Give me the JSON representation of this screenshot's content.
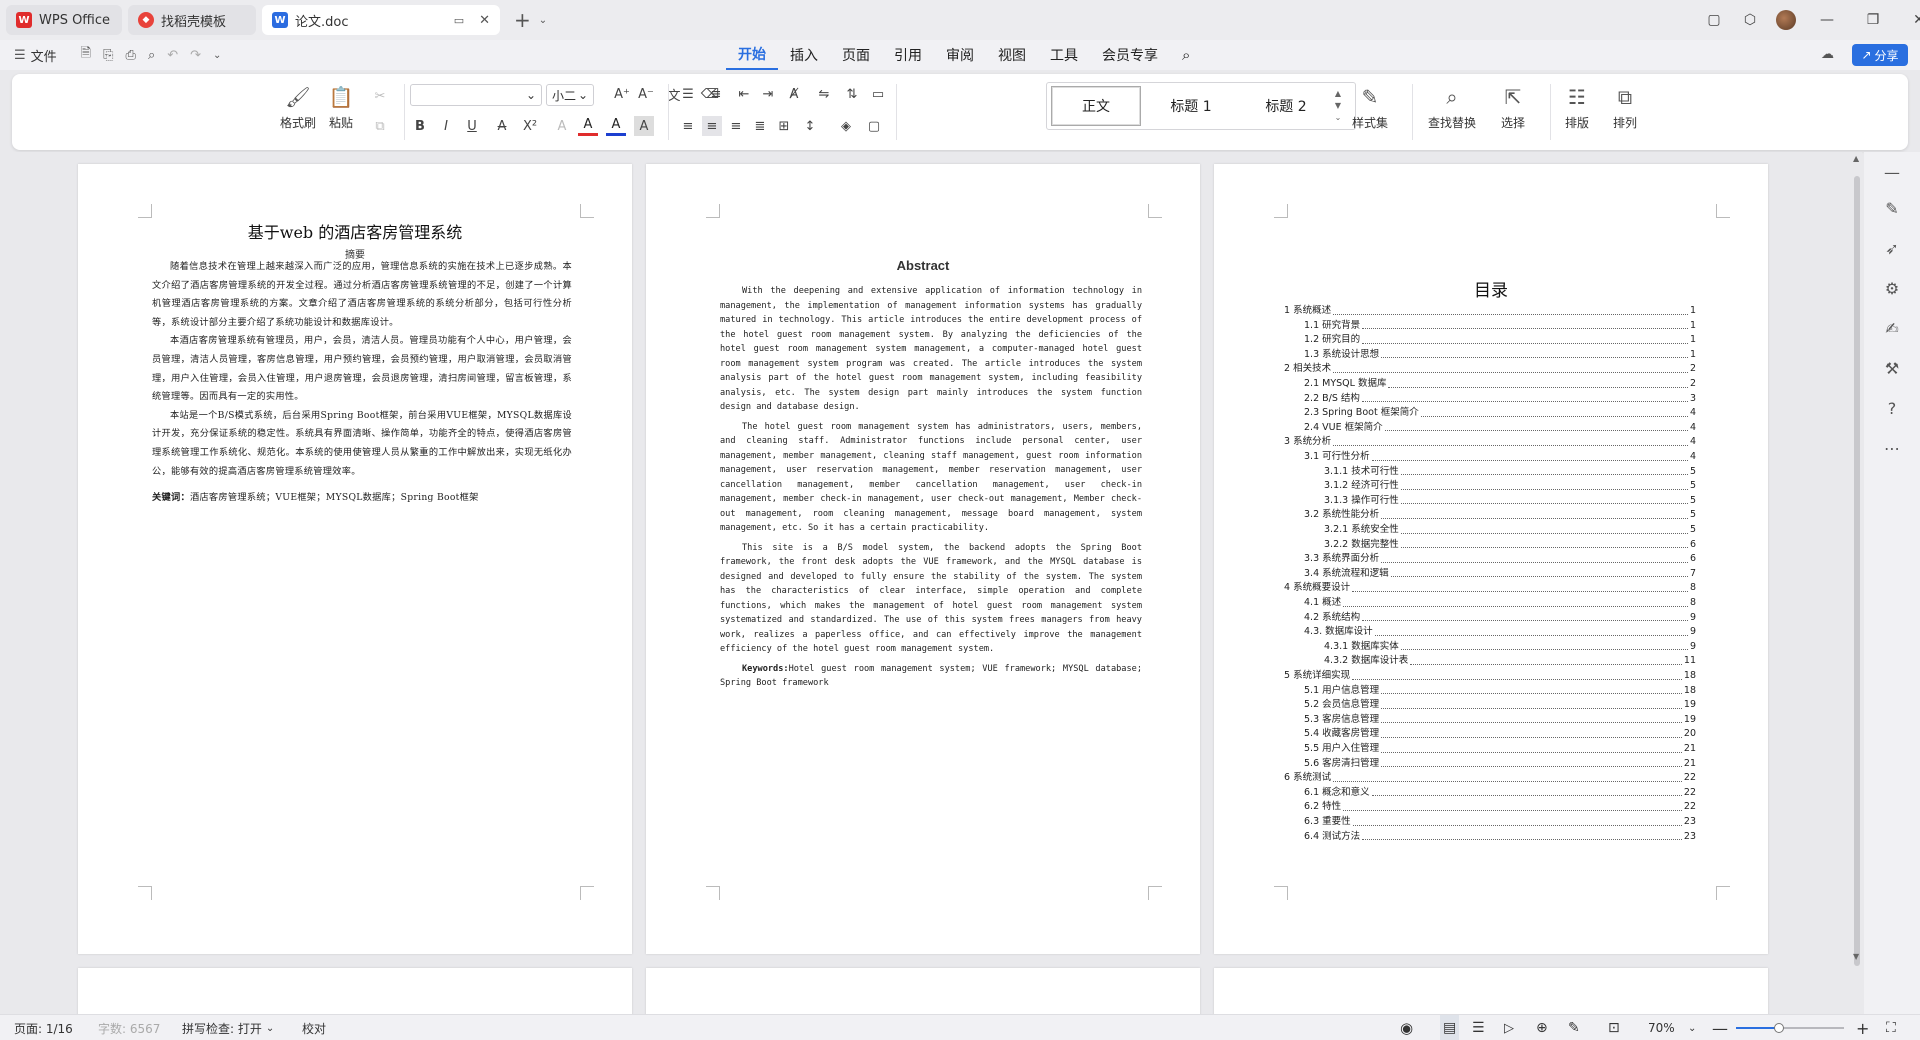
{
  "tabs": [
    {
      "label": "WPS Office"
    },
    {
      "label": "找稻壳模板"
    },
    {
      "label": "论文.doc"
    }
  ],
  "menubar": {
    "file_label": "文件",
    "tabs": [
      "开始",
      "插入",
      "页面",
      "引用",
      "审阅",
      "视图",
      "工具",
      "会员专享"
    ],
    "active_tab": "开始",
    "share_label": "分享"
  },
  "ribbon": {
    "format_painter": "格式刷",
    "paste": "粘贴",
    "font_name": "",
    "font_size": "小二",
    "styles": [
      "正文",
      "标题 1",
      "标题 2"
    ],
    "style_set": "样式集",
    "find_replace": "查找替换",
    "select": "选择",
    "layout": "排版",
    "arrange": "排列"
  },
  "page1": {
    "title": "基于web 的酒店客房管理系统",
    "abstract_label": "摘要",
    "paragraphs": [
      "随着信息技术在管理上越来越深入而广泛的应用，管理信息系统的实施在技术上已逐步成熟。本文介绍了酒店客房管理系统的开发全过程。通过分析酒店客房管理系统管理的不足，创建了一个计算机管理酒店客房管理系统的方案。文章介绍了酒店客房管理系统的系统分析部分，包括可行性分析等，系统设计部分主要介绍了系统功能设计和数据库设计。",
      "本酒店客房管理系统有管理员，用户，会员，清洁人员。管理员功能有个人中心，用户管理，会员管理，清洁人员管理，客房信息管理，用户预约管理，会员预约管理，用户取消管理，会员取消管理，用户入住管理，会员入住管理，用户退房管理，会员退房管理，清扫房间管理，留言板管理，系统管理等。因而具有一定的实用性。",
      "本站是一个B/S模式系统，后台采用Spring Boot框架，前台采用VUE框架，MYSQL数据库设计开发，充分保证系统的稳定性。系统具有界面清晰、操作简单，功能齐全的特点，使得酒店客房管理系统管理工作系统化、规范化。本系统的使用使管理人员从繁重的工作中解放出来，实现无纸化办公，能够有效的提高酒店客房管理系统管理效率。"
    ],
    "keywords_label": "关键词：",
    "keywords": "酒店客房管理系统；VUE框架；MYSQL数据库；Spring Boot框架"
  },
  "page2": {
    "title": "Abstract",
    "paragraphs": [
      "With the deepening and extensive application of information technology in management, the implementation of management information systems has gradually matured in technology. This article introduces the entire development process of the hotel guest room management system. By analyzing the deficiencies of the hotel guest room management system management, a computer-managed hotel guest room management system program was created. The article introduces the system analysis part of the hotel guest room management system, including feasibility analysis, etc. The system design part mainly introduces the system function design and database design.",
      "The hotel guest room management system has administrators, users, members, and cleaning staff. Administrator functions include personal center, user management, member management, cleaning staff management, guest room information management, user reservation management, member reservation management, user cancellation management, member cancellation management, user check-in management, member check-in management, user check-out management, Member check-out management, room cleaning management, message board management, system management, etc. So it has a certain practicability.",
      "This site is a B/S model system, the backend adopts the Spring Boot framework, the front desk adopts the VUE framework, and the MYSQL database is designed and developed to fully ensure the stability of the system. The system has the characteristics of clear interface, simple operation and complete functions, which makes the management of hotel guest room management system systematized and standardized. The use of this system frees managers from heavy work, realizes a paperless office, and can effectively improve the management efficiency of the hotel guest room management system."
    ],
    "keywords_label": "Keywords:",
    "keywords": "Hotel guest room management system; VUE framework; MYSQL database; Spring Boot framework"
  },
  "page3": {
    "title": "目录",
    "toc": [
      {
        "label": "1 系统概述",
        "page": "1",
        "level": 0
      },
      {
        "label": "1.1  研究背景",
        "page": "1",
        "level": 1
      },
      {
        "label": "1.2 研究目的",
        "page": "1",
        "level": 1
      },
      {
        "label": "1.3  系统设计思想",
        "page": "1",
        "level": 1
      },
      {
        "label": "2 相关技术",
        "page": "2",
        "level": 0
      },
      {
        "label": "2.1 MYSQL 数据库",
        "page": "2",
        "level": 1
      },
      {
        "label": "2.2 B/S 结构",
        "page": "3",
        "level": 1
      },
      {
        "label": "2.3 Spring Boot 框架简介",
        "page": "4",
        "level": 1
      },
      {
        "label": "2.4 VUE 框架简介",
        "page": "4",
        "level": 1
      },
      {
        "label": "3 系统分析",
        "page": "4",
        "level": 0
      },
      {
        "label": "3.1 可行性分析",
        "page": "4",
        "level": 1
      },
      {
        "label": "3.1.1 技术可行性",
        "page": "5",
        "level": 2
      },
      {
        "label": "3.1.2 经济可行性",
        "page": "5",
        "level": 2
      },
      {
        "label": "3.1.3 操作可行性",
        "page": "5",
        "level": 2
      },
      {
        "label": "3.2 系统性能分析",
        "page": "5",
        "level": 1
      },
      {
        "label": "3.2.1  系统安全性",
        "page": "5",
        "level": 2
      },
      {
        "label": "3.2.2  数据完整性",
        "page": "6",
        "level": 2
      },
      {
        "label": "3.3 系统界面分析",
        "page": "6",
        "level": 1
      },
      {
        "label": "3.4 系统流程和逻辑",
        "page": "7",
        "level": 1
      },
      {
        "label": "4 系统概要设计",
        "page": "8",
        "level": 0
      },
      {
        "label": "4.1 概述",
        "page": "8",
        "level": 1
      },
      {
        "label": "4.2 系统结构",
        "page": "9",
        "level": 1
      },
      {
        "label": "4.3. 数据库设计",
        "page": "9",
        "level": 1
      },
      {
        "label": "4.3.1 数据库实体",
        "page": "9",
        "level": 2
      },
      {
        "label": "4.3.2 数据库设计表",
        "page": "11",
        "level": 2
      },
      {
        "label": "5 系统详细实现",
        "page": "18",
        "level": 0
      },
      {
        "label": "5.1 用户信息管理",
        "page": "18",
        "level": 1
      },
      {
        "label": "5.2 会员信息管理",
        "page": "19",
        "level": 1
      },
      {
        "label": "5.3 客房信息管理",
        "page": "19",
        "level": 1
      },
      {
        "label": "5.4 收藏客房管理",
        "page": "20",
        "level": 1
      },
      {
        "label": "5.5 用户入住管理",
        "page": "21",
        "level": 1
      },
      {
        "label": "5.6 客房清扫管理",
        "page": "21",
        "level": 1
      },
      {
        "label": "6 系统测试",
        "page": "22",
        "level": 0
      },
      {
        "label": "6.1 概念和意义",
        "page": "22",
        "level": 1
      },
      {
        "label": "6.2 特性",
        "page": "22",
        "level": 1
      },
      {
        "label": "6.3 重要性",
        "page": "23",
        "level": 1
      },
      {
        "label": "6.4 测试方法",
        "page": "23",
        "level": 1
      }
    ]
  },
  "status": {
    "page": "页面: 1/16",
    "words": "字数: 6567",
    "spell": "拼写检查: 打开",
    "proof": "校对",
    "zoom": "70%",
    "zoom_fraction": 0.4
  },
  "colors": {
    "accent": "#2a6fe0",
    "brand_red": "#e02c2c"
  }
}
